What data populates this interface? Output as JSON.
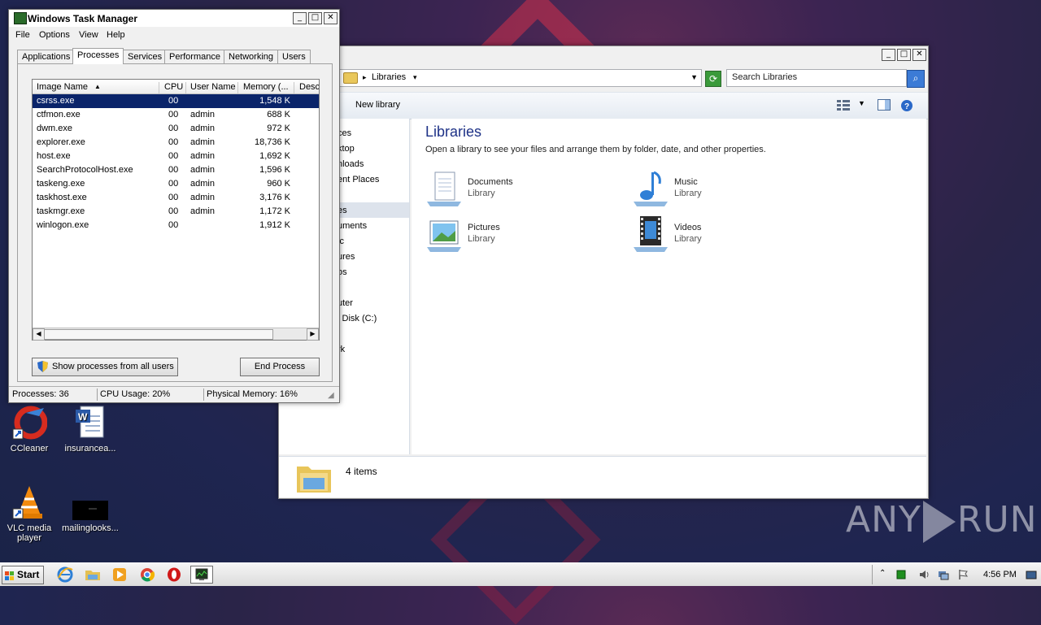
{
  "desktop": {
    "icons": [
      {
        "label": "CCleaner",
        "icon": "ccleaner-icon"
      },
      {
        "label": "insurancea...",
        "icon": "word-document-icon"
      },
      {
        "label": "VLC media player",
        "icon": "vlc-icon"
      },
      {
        "label": "mailinglooks...",
        "icon": "image-thumbnail-icon"
      }
    ],
    "watermark": {
      "left": "ANY",
      "right": "RUN"
    }
  },
  "explorer": {
    "breadcrumb": "Libraries",
    "search_placeholder": "Search Libraries",
    "toolbar": {
      "new_library": "New library"
    },
    "nav": [
      "ces",
      "ktop",
      "nloads",
      "ent Places",
      "es",
      "uments",
      "ic",
      "ures",
      "os",
      "uter",
      "l Disk (C:)",
      "rk"
    ],
    "title": "Libraries",
    "subtitle": "Open a library to see your files and arrange them by folder, date, and other properties.",
    "libraries": [
      {
        "name": "Documents",
        "type": "Library"
      },
      {
        "name": "Music",
        "type": "Library"
      },
      {
        "name": "Pictures",
        "type": "Library"
      },
      {
        "name": "Videos",
        "type": "Library"
      }
    ],
    "details": {
      "count": "4 items"
    }
  },
  "taskmanager": {
    "title": "Windows Task Manager",
    "menu": [
      "File",
      "Options",
      "View",
      "Help"
    ],
    "tabs": [
      "Applications",
      "Processes",
      "Services",
      "Performance",
      "Networking",
      "Users"
    ],
    "active_tab": "Processes",
    "columns": [
      "Image Name",
      "CPU",
      "User Name",
      "Memory (...",
      "Desc"
    ],
    "rows": [
      {
        "name": "csrss.exe",
        "cpu": "00",
        "user": "",
        "mem": "1,548 K"
      },
      {
        "name": "ctfmon.exe",
        "cpu": "00",
        "user": "admin",
        "mem": "688 K"
      },
      {
        "name": "dwm.exe",
        "cpu": "00",
        "user": "admin",
        "mem": "972 K"
      },
      {
        "name": "explorer.exe",
        "cpu": "00",
        "user": "admin",
        "mem": "18,736 K"
      },
      {
        "name": "host.exe",
        "cpu": "00",
        "user": "admin",
        "mem": "1,692 K"
      },
      {
        "name": "SearchProtocolHost.exe",
        "cpu": "00",
        "user": "admin",
        "mem": "1,596 K"
      },
      {
        "name": "taskeng.exe",
        "cpu": "00",
        "user": "admin",
        "mem": "960 K"
      },
      {
        "name": "taskhost.exe",
        "cpu": "00",
        "user": "admin",
        "mem": "3,176 K"
      },
      {
        "name": "taskmgr.exe",
        "cpu": "00",
        "user": "admin",
        "mem": "1,172 K"
      },
      {
        "name": "winlogon.exe",
        "cpu": "00",
        "user": "",
        "mem": "1,912 K"
      }
    ],
    "show_all_button": "Show processes from all users",
    "end_process_button": "End Process",
    "status": {
      "processes": "Processes: 36",
      "cpu": "CPU Usage: 20%",
      "memory": "Physical Memory: 16%"
    }
  },
  "taskbar": {
    "start": "Start",
    "pinned": [
      "internet-explorer-icon",
      "explorer-folder-icon",
      "media-player-icon",
      "chrome-icon",
      "opera-icon",
      "task-manager-icon"
    ],
    "clock": "4:56 PM"
  }
}
